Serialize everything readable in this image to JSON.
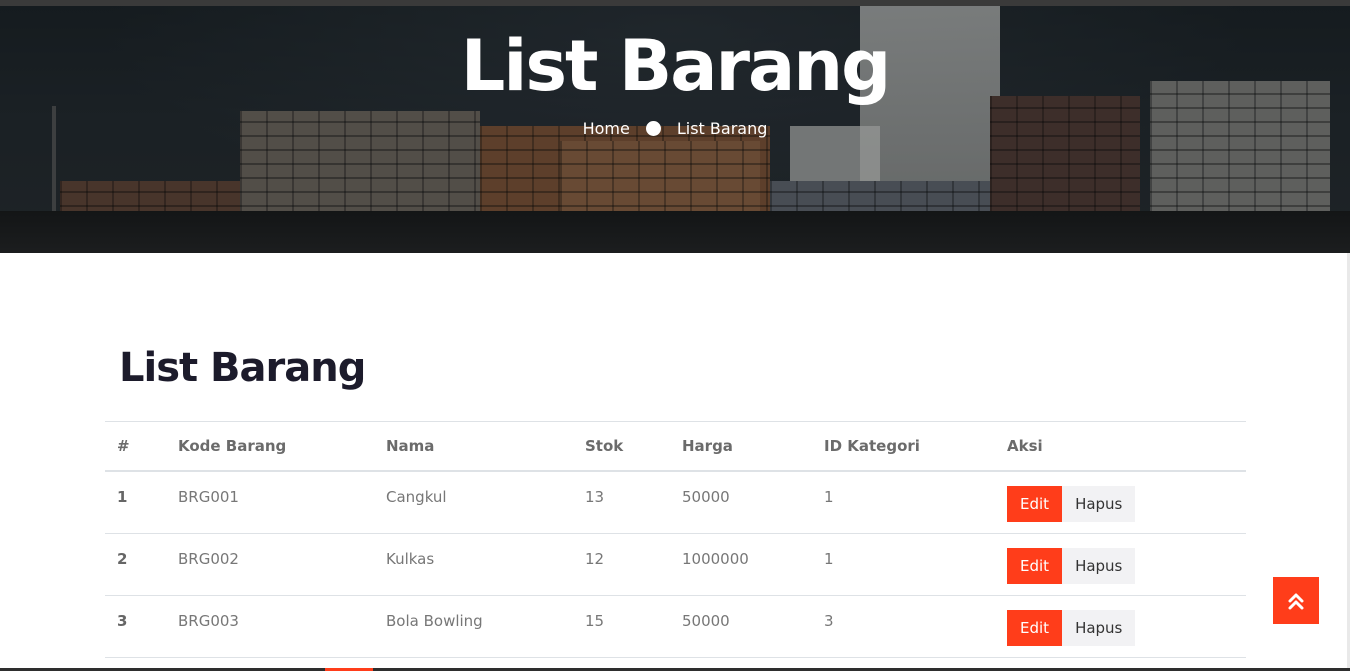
{
  "hero": {
    "title": "List Barang",
    "breadcrumb": {
      "home": "Home",
      "current": "List Barang"
    }
  },
  "section": {
    "title": "List Barang"
  },
  "table": {
    "headers": [
      "#",
      "Kode Barang",
      "Nama",
      "Stok",
      "Harga",
      "ID Kategori",
      "Aksi"
    ],
    "rows": [
      {
        "no": "1",
        "kode": "BRG001",
        "nama": "Cangkul",
        "stok": "13",
        "harga": "50000",
        "kategori": "1"
      },
      {
        "no": "2",
        "kode": "BRG002",
        "nama": "Kulkas",
        "stok": "12",
        "harga": "1000000",
        "kategori": "1"
      },
      {
        "no": "3",
        "kode": "BRG003",
        "nama": "Bola Bowling",
        "stok": "15",
        "harga": "50000",
        "kategori": "3"
      }
    ],
    "edit_label": "Edit",
    "delete_label": "Hapus"
  },
  "icons": {
    "scroll_top": "double-chevron-up-icon"
  },
  "colors": {
    "accent": "#ff3d1a",
    "heading": "#1c1b2b",
    "hapus_bg": "#f2f2f4"
  }
}
